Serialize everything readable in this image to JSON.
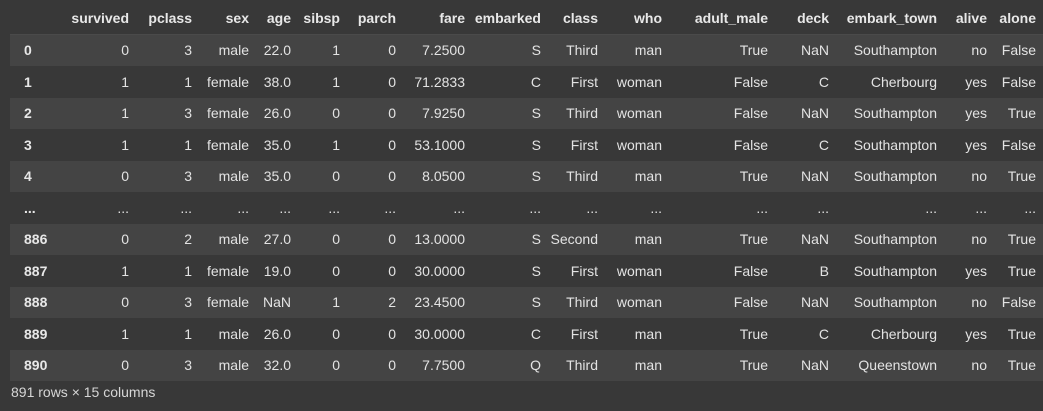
{
  "columns": [
    "survived",
    "pclass",
    "sex",
    "age",
    "sibsp",
    "parch",
    "fare",
    "embarked",
    "class",
    "who",
    "adult_male",
    "deck",
    "embark_town",
    "alive",
    "alone"
  ],
  "rows": [
    {
      "index": "0",
      "cells": [
        "0",
        "3",
        "male",
        "22.0",
        "1",
        "0",
        "7.2500",
        "S",
        "Third",
        "man",
        "True",
        "NaN",
        "Southampton",
        "no",
        "False"
      ]
    },
    {
      "index": "1",
      "cells": [
        "1",
        "1",
        "female",
        "38.0",
        "1",
        "0",
        "71.2833",
        "C",
        "First",
        "woman",
        "False",
        "C",
        "Cherbourg",
        "yes",
        "False"
      ]
    },
    {
      "index": "2",
      "cells": [
        "1",
        "3",
        "female",
        "26.0",
        "0",
        "0",
        "7.9250",
        "S",
        "Third",
        "woman",
        "False",
        "NaN",
        "Southampton",
        "yes",
        "True"
      ]
    },
    {
      "index": "3",
      "cells": [
        "1",
        "1",
        "female",
        "35.0",
        "1",
        "0",
        "53.1000",
        "S",
        "First",
        "woman",
        "False",
        "C",
        "Southampton",
        "yes",
        "False"
      ]
    },
    {
      "index": "4",
      "cells": [
        "0",
        "3",
        "male",
        "35.0",
        "0",
        "0",
        "8.0500",
        "S",
        "Third",
        "man",
        "True",
        "NaN",
        "Southampton",
        "no",
        "True"
      ]
    },
    {
      "index": "...",
      "cells": [
        "...",
        "...",
        "...",
        "...",
        "...",
        "...",
        "...",
        "...",
        "...",
        "...",
        "...",
        "...",
        "...",
        "...",
        "..."
      ]
    },
    {
      "index": "886",
      "cells": [
        "0",
        "2",
        "male",
        "27.0",
        "0",
        "0",
        "13.0000",
        "S",
        "Second",
        "man",
        "True",
        "NaN",
        "Southampton",
        "no",
        "True"
      ]
    },
    {
      "index": "887",
      "cells": [
        "1",
        "1",
        "female",
        "19.0",
        "0",
        "0",
        "30.0000",
        "S",
        "First",
        "woman",
        "False",
        "B",
        "Southampton",
        "yes",
        "True"
      ]
    },
    {
      "index": "888",
      "cells": [
        "0",
        "3",
        "female",
        "NaN",
        "1",
        "2",
        "23.4500",
        "S",
        "Third",
        "woman",
        "False",
        "NaN",
        "Southampton",
        "no",
        "False"
      ]
    },
    {
      "index": "889",
      "cells": [
        "1",
        "1",
        "male",
        "26.0",
        "0",
        "0",
        "30.0000",
        "C",
        "First",
        "man",
        "True",
        "C",
        "Cherbourg",
        "yes",
        "True"
      ]
    },
    {
      "index": "890",
      "cells": [
        "0",
        "3",
        "male",
        "32.0",
        "0",
        "0",
        "7.7500",
        "Q",
        "Third",
        "man",
        "True",
        "NaN",
        "Queenstown",
        "no",
        "True"
      ]
    }
  ],
  "footer": "891 rows × 15 columns",
  "colors": {
    "background": "#383838",
    "row_stripe": "#444444",
    "text": "#e6e6e6"
  }
}
